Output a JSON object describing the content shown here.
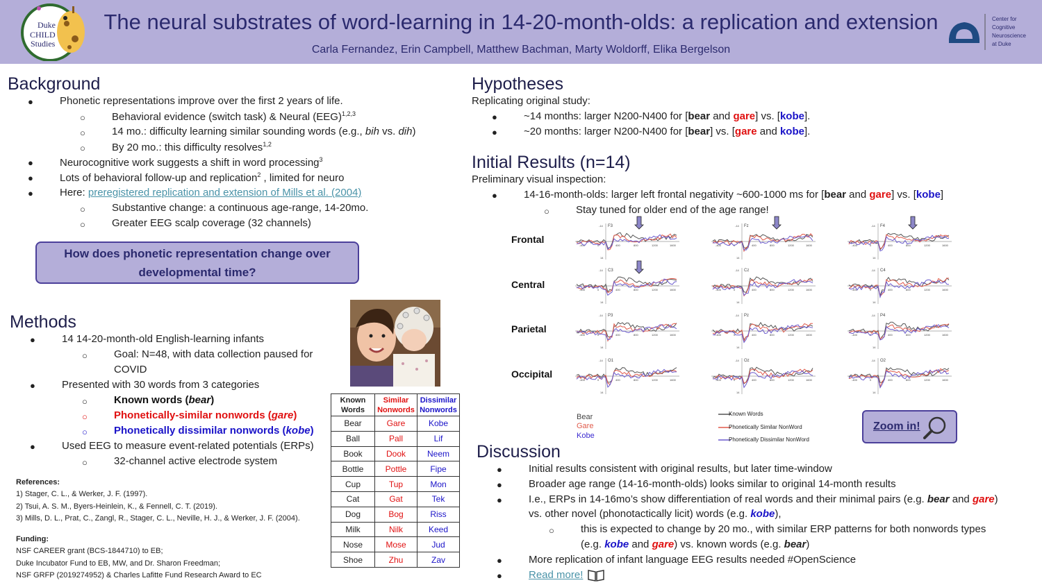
{
  "header": {
    "title": "The neural substrates of word-learning in 14-20-month-olds: a replication and extension",
    "authors": "Carla Fernandez, Erin Campbell, Matthew Bachman, Marty Woldorff, Elika Bergelson",
    "logo_left_line1": "Duke",
    "logo_left_line2": "CHILD",
    "logo_left_line3": "Studies",
    "logo_right_line1": "Center for",
    "logo_right_line2": "Cognitive",
    "logo_right_line3": "Neuroscience",
    "logo_right_line4": "at Duke"
  },
  "background": {
    "heading": "Background",
    "b1": "Phonetic representations improve over the first 2 years of life.",
    "b1_s1": "Behavioral evidence (switch task) & Neural (EEG)",
    "b1_s1_sup": "1,2,3",
    "b1_s2_a": "14 mo.: difficulty learning similar sounding words (e.g., ",
    "b1_s2_b": "bih",
    "b1_s2_c": " vs. ",
    "b1_s2_d": "dih",
    "b1_s2_e": ")",
    "b1_s3": "By 20 mo.: this difficulty resolves",
    "b1_s3_sup": "1,2",
    "b2": "Neurocognitive work suggests a shift in word processing",
    "b2_sup": "3",
    "b3": "Lots of behavioral follow-up and replication",
    "b3_sup": "2",
    "b3_tail": " , limited for neuro",
    "b4": "Here:  ",
    "b4_link": "preregistered replication and extension of Mills et al. (2004)",
    "b4_s1": "Substantive change: a continuous age-range, 14-20mo.",
    "b4_s2": "Greater EEG scalp coverage (32 channels)",
    "question": "How does phonetic representation change over developmental time?"
  },
  "methods": {
    "heading": "Methods",
    "b1": "14 14-20-month-old English-learning infants",
    "b1_s1": "Goal: N=48, with data collection paused for",
    "b1_s1_cont": "COVID",
    "b2": "Presented with 30 words from 3 categories",
    "b2_s1": "Known words (",
    "b2_s1_word": "bear",
    "b2_s2": "Phonetically-similar nonwords (",
    "b2_s2_word": "gare",
    "b2_s3": "Phonetically dissimilar nonwords (",
    "b2_s3_word": "kobe",
    "close_paren": ")",
    "b3": "Used EEG to measure event-related potentials (ERPs)",
    "b3_s1": "32-channel active electrode system"
  },
  "references": {
    "heading": "References:",
    "r1": "1) Stager, C. L., & Werker, J. F. (1997).",
    "r2": "2) Tsui, A. S. M., Byers-Heinlein, K., & Fennell, C. T. (2019).",
    "r3": "3) Mills, D. L., Prat, C., Zangl, R., Stager, C. L., Neville, H. J., & Werker, J. F. (2004).",
    "funding_heading": "Funding:",
    "f1": "NSF CAREER grant (BCS-1844710) to EB;",
    "f2": "Duke Incubator Fund to EB, MW, and Dr. Sharon Freedman;",
    "f3": "NSF GRFP (2019274952) & Charles Lafitte Fund Research Award to EC"
  },
  "word_table": {
    "headers": [
      [
        "Known",
        "Words"
      ],
      [
        "Similar",
        "Nonwords"
      ],
      [
        "Dissimilar",
        "Nonwords"
      ]
    ],
    "rows": [
      [
        "Bear",
        "Gare",
        "Kobe"
      ],
      [
        "Ball",
        "Pall",
        "Lif"
      ],
      [
        "Book",
        "Dook",
        "Neem"
      ],
      [
        "Bottle",
        "Pottle",
        "Fipe"
      ],
      [
        "Cup",
        "Tup",
        "Mon"
      ],
      [
        "Cat",
        "Gat",
        "Tek"
      ],
      [
        "Dog",
        "Bog",
        "Riss"
      ],
      [
        "Milk",
        "Nilk",
        "Keed"
      ],
      [
        "Nose",
        "Mose",
        "Jud"
      ],
      [
        "Shoe",
        "Zhu",
        "Zav"
      ]
    ]
  },
  "hypotheses": {
    "heading": "Hypotheses",
    "intro": "Replicating original study:",
    "h1_a": "~14 months: larger  N200-N400 for [",
    "h1_b": "bear",
    "h1_c": " and ",
    "h1_d": "gare",
    "h1_e": "] vs. [",
    "h1_f": "kobe",
    "h1_g": "].",
    "h2_a": "~20 months: larger N200-N400 for [",
    "h2_b": "bear",
    "h2_c": "] vs. [",
    "h2_d": "gare",
    "h2_e": " and ",
    "h2_f": "kobe",
    "h2_g": "]."
  },
  "results": {
    "heading": "Initial Results (n=14)",
    "intro": "Preliminary visual inspection:",
    "b1_a": "14-16-month-olds: larger left frontal negativity ~600-1000 ms for [",
    "b1_b": "bear",
    "b1_c": " and ",
    "b1_d": "gare",
    "b1_e": "] vs. [",
    "b1_f": "kobe",
    "b1_g": "]",
    "b1_s1": "Stay tuned for older end of the age range!",
    "rows": [
      "Frontal",
      "Central",
      "Parietal",
      "Occipital"
    ],
    "channels": [
      [
        "F3",
        "Fz",
        "F4"
      ],
      [
        "C3",
        "Cz",
        "C4"
      ],
      [
        "P3",
        "Pz",
        "P4"
      ],
      [
        "O1",
        "Oz",
        "O2"
      ]
    ],
    "ticks": [
      "-400",
      "0",
      "400",
      "800",
      "1200",
      "1600"
    ],
    "y_ticks": [
      "-14",
      "14"
    ],
    "legend_left": [
      "Bear",
      "Gare",
      "Kobe"
    ],
    "legend_right": [
      "Known Words",
      "Phonetically Similar NonWord",
      "Phonetically Dissimilar NonWord"
    ],
    "colors": {
      "bear": "#555555",
      "gare": "#e05a4a",
      "kobe": "#6a5acd"
    },
    "zoom": "Zoom in!"
  },
  "discussion": {
    "heading": "Discussion",
    "d1": "Initial results consistent with original results, but later time-window",
    "d2": "Broader age range (14-16-month-olds) looks similar to original 14-month results",
    "d3_a": "I.e., ERPs in 14-16mo’s show differentiation of real words and their minimal pairs (e.g. ",
    "d3_b": "bear",
    "d3_c": " and ",
    "d3_d": "gare",
    "d3_e": ")",
    "d3_line2_a": "vs. other novel (phonotactically licit) words (e.g. ",
    "d3_line2_b": "kobe",
    "d3_line2_c": "),",
    "d3_s1": "this is expected to change by 20 mo., with similar ERP patterns for both nonwords types",
    "d3_s1_a": "(e.g. ",
    "d3_s1_b": "kobe",
    "d3_s1_c": " and ",
    "d3_s1_d": "gare",
    "d3_s1_e": ")  vs. known words (e.g. ",
    "d3_s1_f": "bear",
    "d3_s1_g": ")",
    "d4": "More replication of infant language EEG results needed  #OpenScience",
    "d5": "Read more!"
  }
}
